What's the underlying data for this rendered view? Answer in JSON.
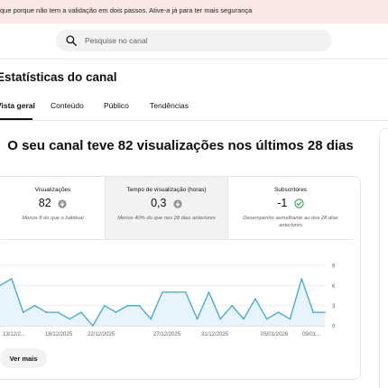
{
  "banner": {
    "text": "que porque não tem a validação em dois passos. Ative-a já para ter mais segurança"
  },
  "search": {
    "placeholder": "Pesquise no canal",
    "icon": "search-icon"
  },
  "page": {
    "title": "Estatísticas do canal"
  },
  "tabs": [
    {
      "label": "Vista geral",
      "active": true
    },
    {
      "label": "Conteúdo",
      "active": false
    },
    {
      "label": "Público",
      "active": false
    },
    {
      "label": "Tendências",
      "active": false
    }
  ],
  "headline": "O seu canal teve 82 visualizações nos últimos 28 dias",
  "metrics": [
    {
      "label": "Visualizações",
      "value": "82",
      "icon": "arrow-down-circle-icon",
      "note": "Menos 8 do que o habitual"
    },
    {
      "label": "Tempo de visualização (horas)",
      "value": "0,3",
      "icon": "arrow-down-circle-icon",
      "note": "Menos 40% do que nos 28 dias anteriores"
    },
    {
      "label": "Subscritores",
      "value": "-1",
      "icon": "check-circle-icon",
      "note": "Desempenho semelhante ao dos 28 dias anteriores"
    }
  ],
  "colors": {
    "line": "#40a8d4",
    "area": "#e8f4fb",
    "down_icon": "#909090",
    "check_icon": "#2ba640",
    "banner_bg": "#fbe6e6"
  },
  "chart_data": {
    "type": "line",
    "x_tick_labels": [
      "13/12/2...",
      "18/12/2025",
      "22/12/2025",
      "27/12/2025",
      "31/12/2025",
      "05/01/2026",
      "09/01..."
    ],
    "y_ticks": [
      0,
      3,
      6,
      9
    ],
    "ylim": [
      0,
      9
    ],
    "grid": true,
    "series": [
      {
        "values": [
          6,
          7,
          2,
          3,
          2,
          2,
          1,
          2,
          0,
          3,
          2,
          3,
          3,
          1,
          5,
          5,
          5,
          1,
          5,
          1,
          3,
          1,
          4,
          1,
          2,
          1,
          7,
          2,
          2
        ]
      }
    ]
  },
  "see_more_label": "Ver mais"
}
